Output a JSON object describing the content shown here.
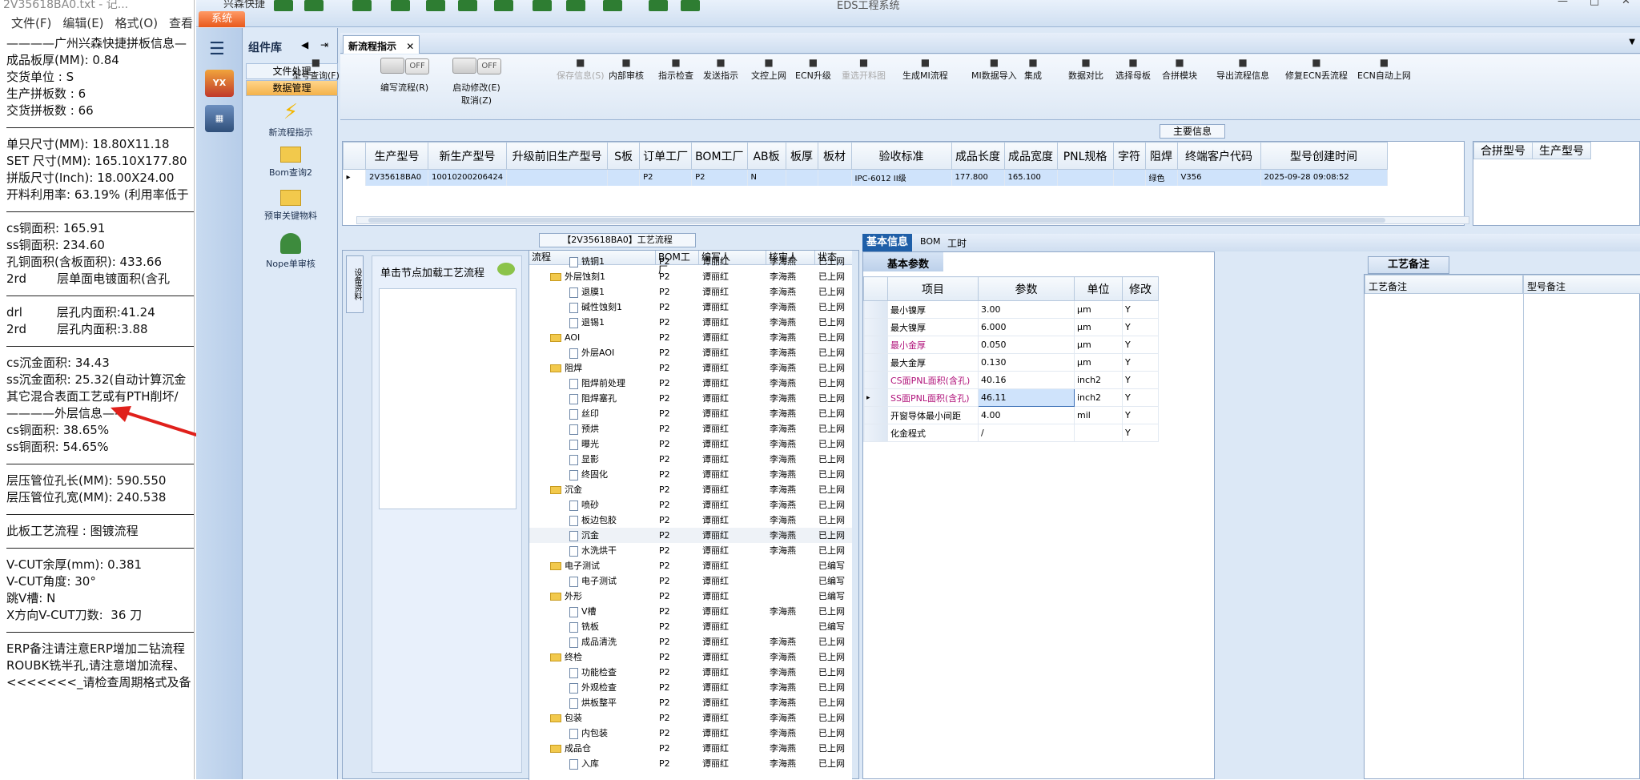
{
  "notepad": {
    "title": "2V35618BA0.txt - 记...",
    "menu": [
      "文件(F)",
      "编辑(E)",
      "格式(O)",
      "查看("
    ],
    "blocks": [
      [
        "————广州兴森快捷拼板信息—",
        "成品板厚(MM): 0.84",
        "交货单位 : S",
        "生产拼板数 : 6",
        "交货拼板数 : 66"
      ],
      [
        "单只尺寸(MM): 18.80X11.18",
        "SET 尺寸(MM): 165.10X177.80",
        "拼版尺寸(Inch): 18.00X24.00",
        "开料利用率: 63.19% (利用率低于"
      ],
      [
        "cs铜面积: 165.91",
        "ss铜面积: 234.60",
        "孔铜面积(含板面积): 433.66",
        "2rd        层单面电镀面积(含孔"
      ],
      [
        "drl         层孔内面积:41.24",
        "2rd        层孔内面积:3.88"
      ],
      [
        "cs沉金面积: 34.43",
        "ss沉金面积: 25.32(自动计算沉金",
        "其它混合表面工艺或有PTH削坏/",
        "————外层信息——",
        "cs铜面积: 38.65%",
        "ss铜面积: 54.65%"
      ],
      [
        "层压管位孔长(MM): 590.550",
        "层压管位孔宽(MM): 240.538"
      ],
      [
        "此板工艺流程 : 图镀流程"
      ],
      [
        "V-CUT余厚(mm): 0.381",
        "V-CUT角度: 30°",
        "跳V槽: N",
        "X方向V-CUT刀数:  36 刀"
      ],
      [
        "ERP备注请注意ERP增加二钻流程",
        "ROUBK铣半孔,请注意增加流程、",
        "<<<<<<<_请检查周期格式及备"
      ]
    ]
  },
  "app": {
    "brand": "兴森快捷",
    "system_tab": "系统",
    "window_title": "EDS工程系统",
    "colors": {
      "accent": "#1f5fa8",
      "system": "#e8591b",
      "selected_row": "#cfe3fb"
    }
  },
  "component_lib": {
    "title": "组件库",
    "tabs": [
      "文件处理",
      "数据管理"
    ],
    "items": [
      "新流程指示",
      "Bom查询2",
      "预审关键物料",
      "Nope单审核"
    ]
  },
  "main_tab": {
    "label": "新流程指示"
  },
  "toolbar": {
    "items": [
      {
        "label": "型号查询(F)",
        "icon": "search-icon"
      },
      {
        "label": "编写流程(R)",
        "icon": "toggle-off"
      },
      {
        "label": "启动修改(E)",
        "sub": "取消(Z)",
        "icon": "toggle-off"
      },
      {
        "label": "保存信息(S)",
        "icon": "save-icon"
      },
      {
        "label": "内部审核",
        "icon": "print-icon"
      },
      {
        "label": "指示检查",
        "icon": "check-icon"
      },
      {
        "label": "发送指示",
        "icon": "upload-icon"
      },
      {
        "label": "文控上网",
        "icon": "cloud-icon"
      },
      {
        "label": "ECN升级",
        "icon": "ecn-icon"
      },
      {
        "label": "重选开料图",
        "icon": "image-icon"
      },
      {
        "label": "生成MI流程",
        "icon": "flow-icon"
      },
      {
        "label": "MI数据导入",
        "icon": "import-icon"
      },
      {
        "label": "集成",
        "icon": "download-icon"
      },
      {
        "label": "数据对比",
        "icon": "compare-icon"
      },
      {
        "label": "选择母板",
        "icon": "select-icon"
      },
      {
        "label": "合拼模块",
        "icon": "list-icon"
      },
      {
        "label": "导出流程信息",
        "icon": "export-icon"
      },
      {
        "label": "修复ECN丢流程",
        "icon": "wrench-icon"
      },
      {
        "label": "ECN自动上网",
        "icon": "star-icon"
      }
    ],
    "toggle_text": "OFF"
  },
  "main_info": {
    "caption": "主要信息",
    "columns": [
      "生产型号",
      "新生产型号",
      "升级前旧生产型号",
      "S板",
      "订单工厂",
      "BOM工厂",
      "AB板",
      "板厚",
      "板材",
      "验收标准",
      "成品长度",
      "成品宽度",
      "PNL规格",
      "字符",
      "阻焊",
      "终端客户代码",
      "型号创建时间"
    ],
    "row": [
      "2V35618BA0",
      "10010200206424",
      "",
      "",
      "P2",
      "P2",
      "N",
      "",
      "",
      "IPC-6012 II级",
      "177.800",
      "165.100",
      "",
      "",
      "绿色",
      "V356",
      "2025-09-28 09:08:52"
    ],
    "side_columns": [
      "合拼型号",
      "生产型号"
    ]
  },
  "process": {
    "caption": "【2V35618BA0】工艺流程",
    "side_tab": "设备资料",
    "note_header": "单击节点加载工艺流程",
    "columns": [
      "流程",
      "BOM工厂",
      "编写人",
      "核审人",
      "状态"
    ],
    "rows": [
      {
        "level": 2,
        "name": "铣铜1",
        "bom": "P2",
        "writer": "谭丽红",
        "checker": "李海燕",
        "status": "已上网"
      },
      {
        "level": 1,
        "name": "外层蚀刻1",
        "bom": "P2",
        "writer": "谭丽红",
        "checker": "李海燕",
        "status": "已上网"
      },
      {
        "level": 2,
        "name": "退膜1",
        "bom": "P2",
        "writer": "谭丽红",
        "checker": "李海燕",
        "status": "已上网"
      },
      {
        "level": 2,
        "name": "碱性蚀刻1",
        "bom": "P2",
        "writer": "谭丽红",
        "checker": "李海燕",
        "status": "已上网"
      },
      {
        "level": 2,
        "name": "退锡1",
        "bom": "P2",
        "writer": "谭丽红",
        "checker": "李海燕",
        "status": "已上网"
      },
      {
        "level": 1,
        "name": "AOI",
        "bom": "P2",
        "writer": "谭丽红",
        "checker": "李海燕",
        "status": "已上网"
      },
      {
        "level": 2,
        "name": "外层AOI",
        "bom": "P2",
        "writer": "谭丽红",
        "checker": "李海燕",
        "status": "已上网"
      },
      {
        "level": 1,
        "name": "阻焊",
        "bom": "P2",
        "writer": "谭丽红",
        "checker": "李海燕",
        "status": "已上网"
      },
      {
        "level": 2,
        "name": "阻焊前处理",
        "bom": "P2",
        "writer": "谭丽红",
        "checker": "李海燕",
        "status": "已上网"
      },
      {
        "level": 2,
        "name": "阻焊塞孔",
        "bom": "P2",
        "writer": "谭丽红",
        "checker": "李海燕",
        "status": "已上网"
      },
      {
        "level": 2,
        "name": "丝印",
        "bom": "P2",
        "writer": "谭丽红",
        "checker": "李海燕",
        "status": "已上网"
      },
      {
        "level": 2,
        "name": "预烘",
        "bom": "P2",
        "writer": "谭丽红",
        "checker": "李海燕",
        "status": "已上网"
      },
      {
        "level": 2,
        "name": "曝光",
        "bom": "P2",
        "writer": "谭丽红",
        "checker": "李海燕",
        "status": "已上网"
      },
      {
        "level": 2,
        "name": "显影",
        "bom": "P2",
        "writer": "谭丽红",
        "checker": "李海燕",
        "status": "已上网"
      },
      {
        "level": 2,
        "name": "终固化",
        "bom": "P2",
        "writer": "谭丽红",
        "checker": "李海燕",
        "status": "已上网"
      },
      {
        "level": 1,
        "name": "沉金",
        "bom": "P2",
        "writer": "谭丽红",
        "checker": "李海燕",
        "status": "已上网"
      },
      {
        "level": 2,
        "name": "喷砂",
        "bom": "P2",
        "writer": "谭丽红",
        "checker": "李海燕",
        "status": "已上网"
      },
      {
        "level": 2,
        "name": "板边包胶",
        "bom": "P2",
        "writer": "谭丽红",
        "checker": "李海燕",
        "status": "已上网"
      },
      {
        "level": 2,
        "name": "沉金",
        "bom": "P2",
        "writer": "谭丽红",
        "checker": "李海燕",
        "status": "已上网"
      },
      {
        "level": 2,
        "name": "水洗烘干",
        "bom": "P2",
        "writer": "谭丽红",
        "checker": "李海燕",
        "status": "已上网"
      },
      {
        "level": 1,
        "name": "电子测试",
        "bom": "P2",
        "writer": "谭丽红",
        "checker": "",
        "status": "已编写"
      },
      {
        "level": 2,
        "name": "电子测试",
        "bom": "P2",
        "writer": "谭丽红",
        "checker": "",
        "status": "已编写"
      },
      {
        "level": 1,
        "name": "外形",
        "bom": "P2",
        "writer": "谭丽红",
        "checker": "",
        "status": "已编写"
      },
      {
        "level": 2,
        "name": "V槽",
        "bom": "P2",
        "writer": "谭丽红",
        "checker": "李海燕",
        "status": "已上网"
      },
      {
        "level": 2,
        "name": "铣板",
        "bom": "P2",
        "writer": "谭丽红",
        "checker": "",
        "status": "已编写"
      },
      {
        "level": 2,
        "name": "成品清洗",
        "bom": "P2",
        "writer": "谭丽红",
        "checker": "李海燕",
        "status": "已上网"
      },
      {
        "level": 1,
        "name": "终检",
        "bom": "P2",
        "writer": "谭丽红",
        "checker": "李海燕",
        "status": "已上网"
      },
      {
        "level": 2,
        "name": "功能检查",
        "bom": "P2",
        "writer": "谭丽红",
        "checker": "李海燕",
        "status": "已上网"
      },
      {
        "level": 2,
        "name": "外观检查",
        "bom": "P2",
        "writer": "谭丽红",
        "checker": "李海燕",
        "status": "已上网"
      },
      {
        "level": 2,
        "name": "烘板整平",
        "bom": "P2",
        "writer": "谭丽红",
        "checker": "李海燕",
        "status": "已上网"
      },
      {
        "level": 1,
        "name": "包装",
        "bom": "P2",
        "writer": "谭丽红",
        "checker": "李海燕",
        "status": "已上网"
      },
      {
        "level": 2,
        "name": "内包装",
        "bom": "P2",
        "writer": "谭丽红",
        "checker": "李海燕",
        "status": "已上网"
      },
      {
        "level": 1,
        "name": "成品仓",
        "bom": "P2",
        "writer": "谭丽红",
        "checker": "李海燕",
        "status": "已上网"
      },
      {
        "level": 2,
        "name": "入库",
        "bom": "P2",
        "writer": "谭丽红",
        "checker": "李海燕",
        "status": "已上网"
      }
    ]
  },
  "basic_info": {
    "tabs": [
      "基本信息",
      "BOM",
      "工时"
    ],
    "sub_tab": "基本参数",
    "columns": [
      "项目",
      "参数",
      "单位",
      "修改"
    ],
    "rows": [
      {
        "item": "最小镍厚",
        "param": "3.00",
        "unit": "μm",
        "mod": "Y",
        "highlight": false
      },
      {
        "item": "最大镍厚",
        "param": "6.000",
        "unit": "μm",
        "mod": "Y",
        "highlight": false
      },
      {
        "item": "最小金厚",
        "param": "0.050",
        "unit": "μm",
        "mod": "Y",
        "highlight": true
      },
      {
        "item": "最大金厚",
        "param": "0.130",
        "unit": "μm",
        "mod": "Y",
        "highlight": false
      },
      {
        "item": "CS面PNL面积(含孔)",
        "param": "40.16",
        "unit": "inch2",
        "mod": "Y",
        "highlight": true
      },
      {
        "item": "SS面PNL面积(含孔)",
        "param": "46.11",
        "unit": "inch2",
        "mod": "Y",
        "highlight": true
      },
      {
        "item": "开窗导体最小间距",
        "param": "4.00",
        "unit": "mil",
        "mod": "Y",
        "highlight": false
      },
      {
        "item": "化金程式",
        "param": "/",
        "unit": "",
        "mod": "Y",
        "highlight": false
      }
    ]
  },
  "remarks": {
    "tab": "工艺备注",
    "columns": [
      "工艺备注",
      "型号备注"
    ]
  }
}
